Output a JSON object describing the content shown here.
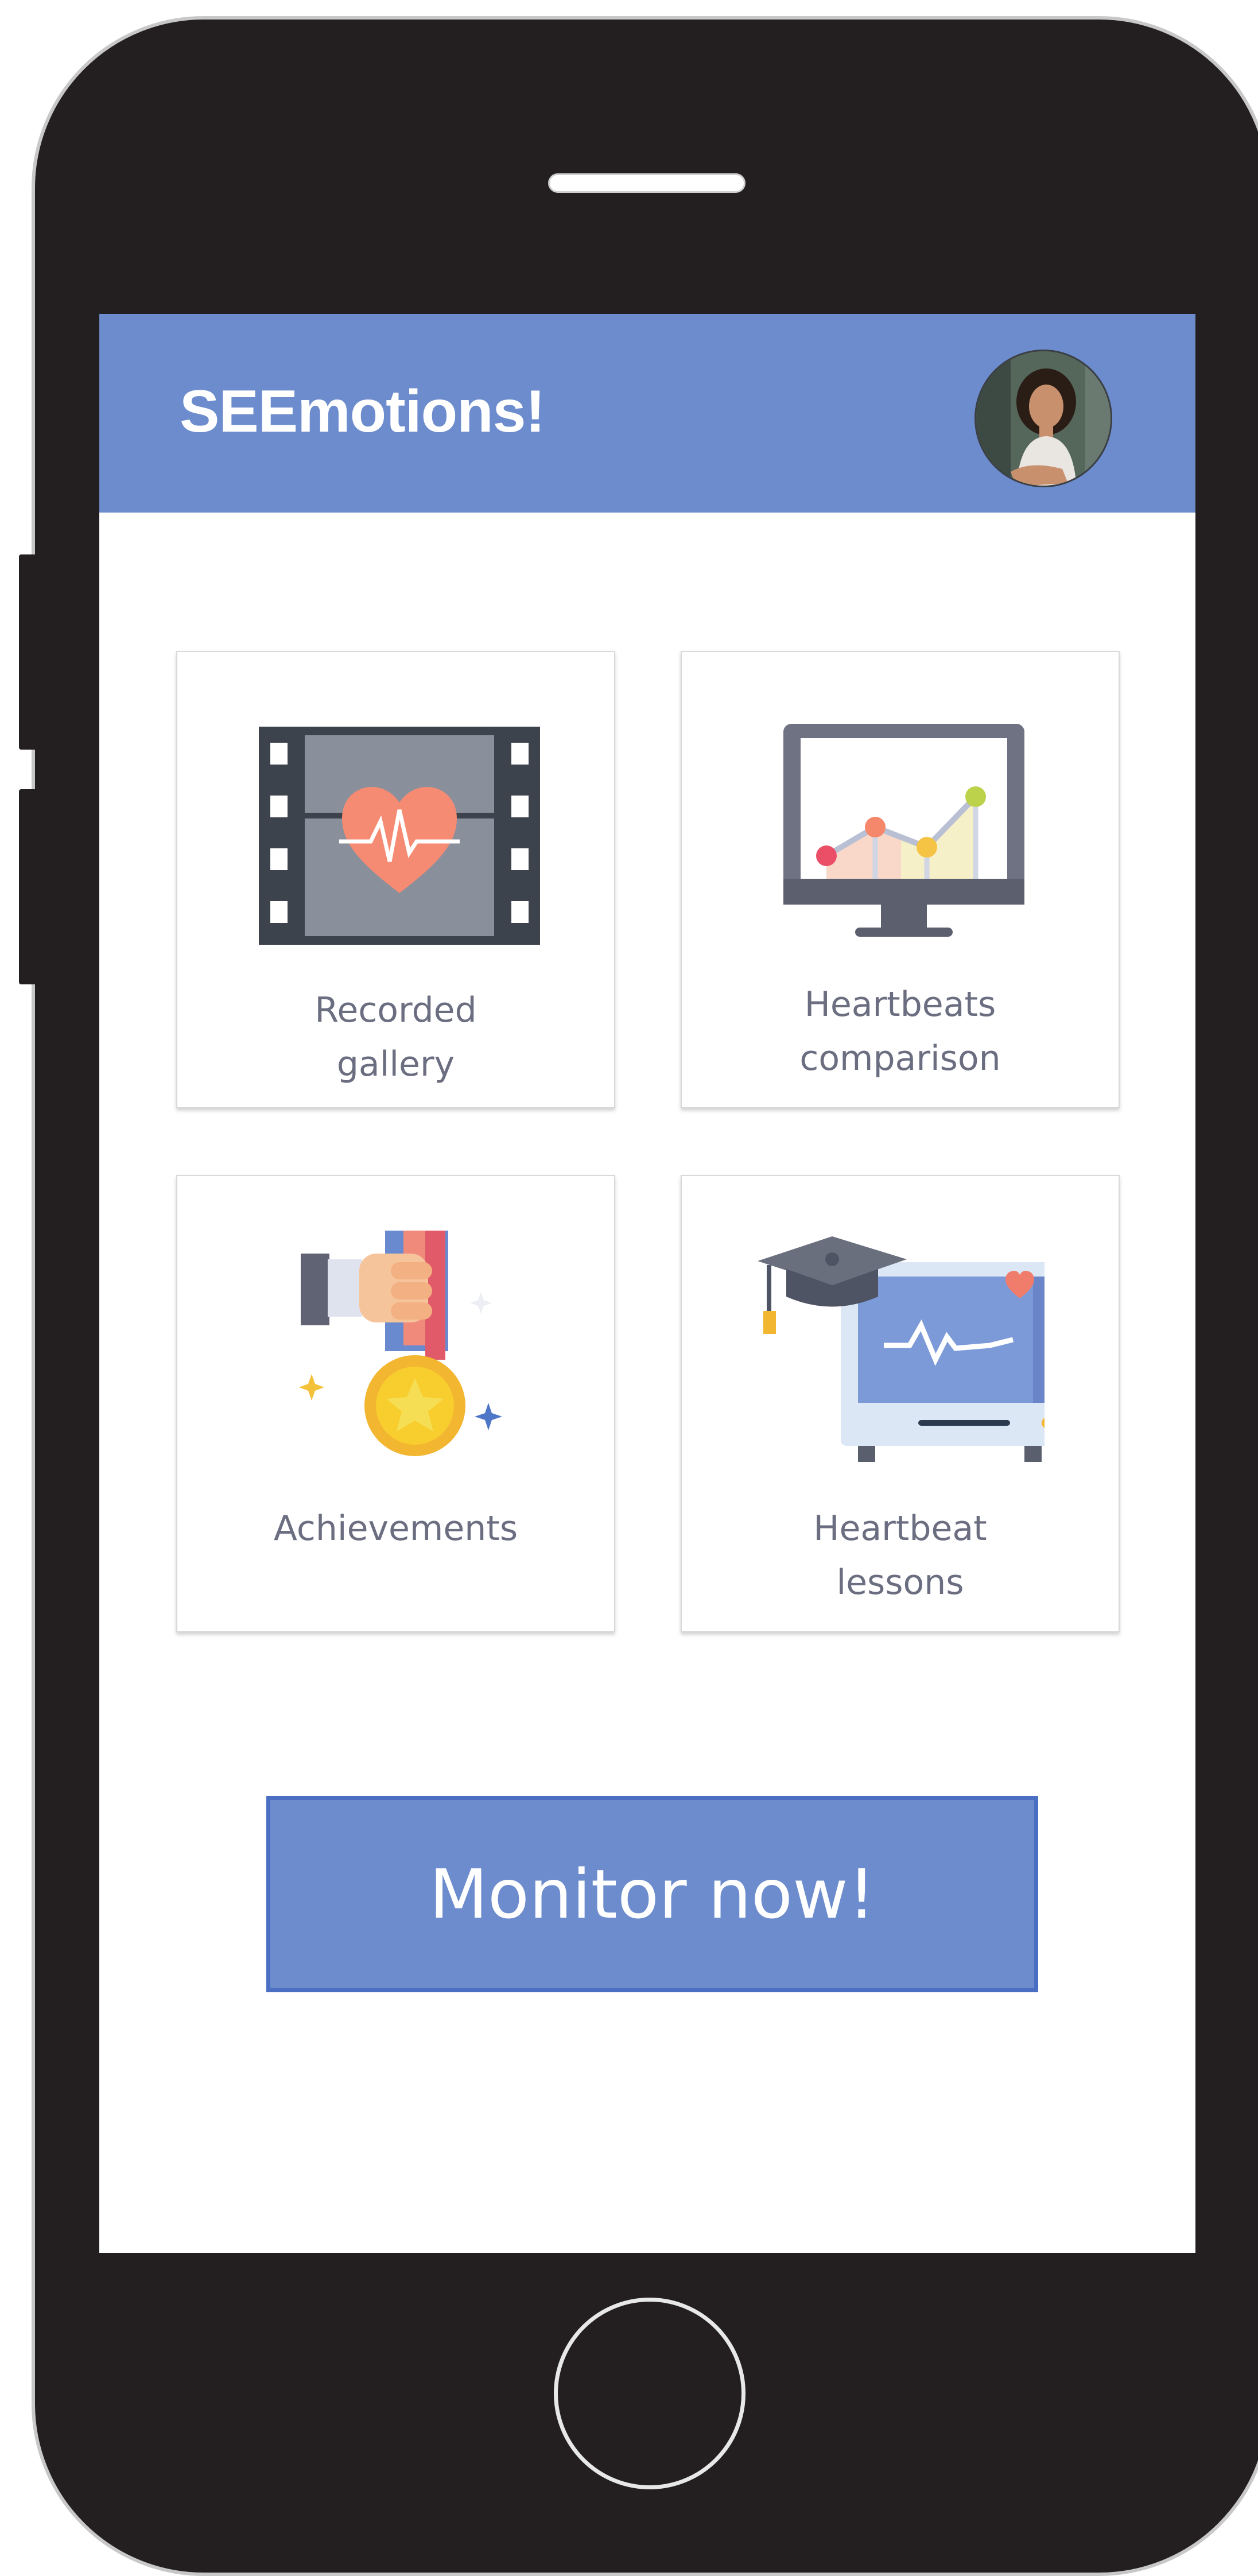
{
  "app": {
    "title": "SEEmotions!",
    "header_color": "#6c8ccd",
    "profile_avatar": "woman-profile-photo"
  },
  "tiles": [
    {
      "label": "Recorded\ngallery",
      "icon": "film-heartbeat-icon"
    },
    {
      "label": "Heartbeats\ncomparison",
      "icon": "monitor-line-chart-icon"
    },
    {
      "label": "Achievements",
      "icon": "medal-hand-icon"
    },
    {
      "label": "Heartbeat\nlessons",
      "icon": "graduation-cap-heart-monitor-icon"
    }
  ],
  "primary_action": {
    "label": "Monitor now!",
    "color": "#6c8ccd",
    "border_color": "#4a6fc2"
  },
  "device": {
    "frame_color": "#231f20"
  }
}
